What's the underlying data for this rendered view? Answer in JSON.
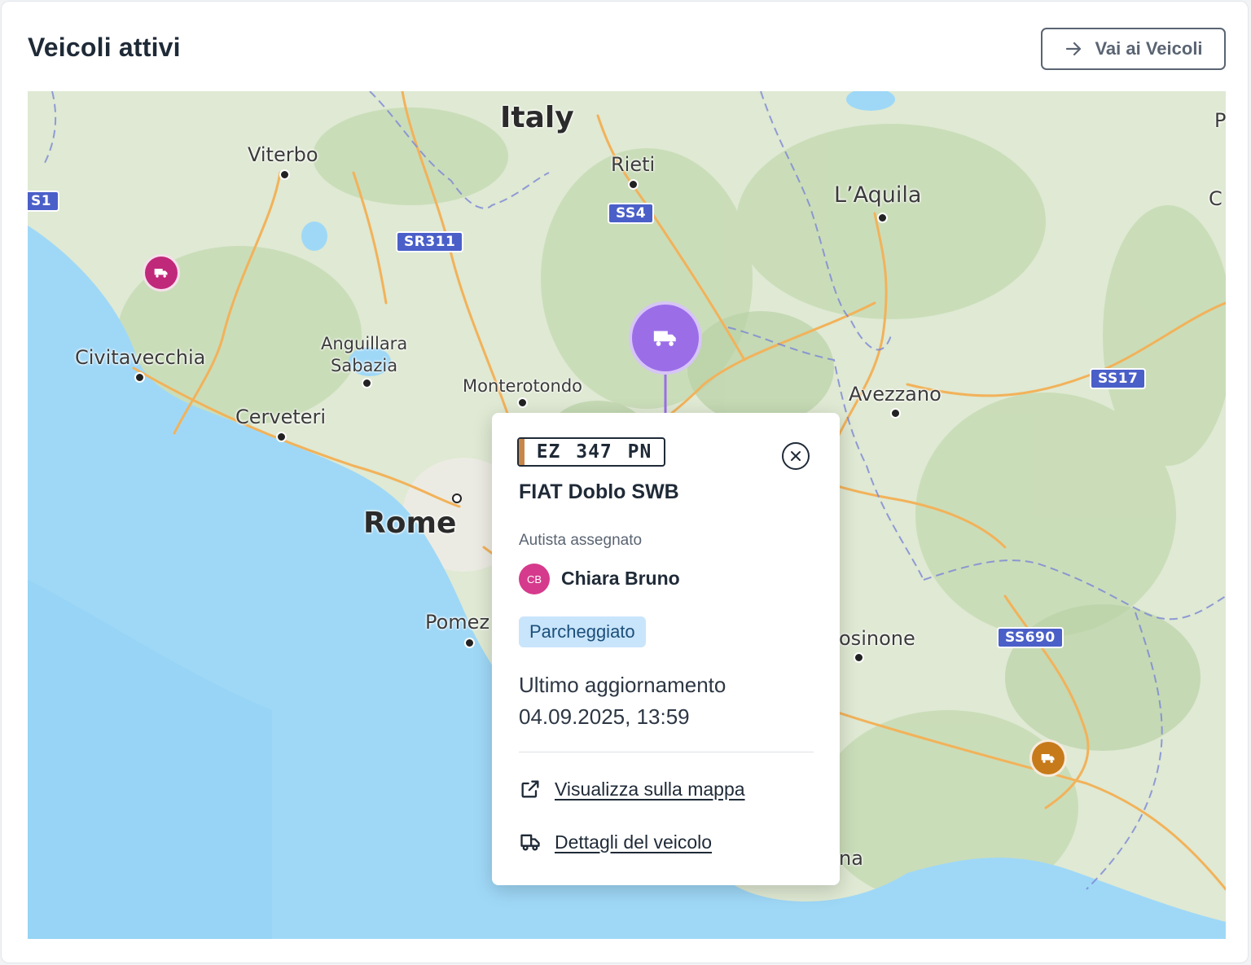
{
  "header": {
    "title": "Veicoli attivi",
    "go_button_label": "Vai ai Veicoli"
  },
  "map": {
    "labels": {
      "italy": "Italy",
      "viterbo": "Viterbo",
      "rieti": "Rieti",
      "laquila": "L’Aquila",
      "civitavecchia": "Civitavecchia",
      "anguillara": "Anguillara",
      "sabazia": "Sabazia",
      "monterotondo": "Monterotondo",
      "avezzano": "Avezzano",
      "cerveteri": "Cerveteri",
      "rome": "Rome",
      "pomezia": "Pomez",
      "frosinone": "osinone",
      "terracina": "na",
      "edge_p": "P",
      "edge_c": "C"
    },
    "road_shields": {
      "s1": "S1",
      "sr311": "SR311",
      "ss4": "SS4",
      "ss17": "SS17",
      "ss690": "SS690"
    },
    "colors": {
      "sea": "#9fd8f7",
      "land": "#dfe9d3",
      "road": "#f2b25a",
      "marker_selected": "#9b6ee8",
      "marker_magenta": "#c0287a",
      "marker_orange": "#c77a1a"
    }
  },
  "popup": {
    "plate": "EZ 347 PN",
    "vehicle_name": "FIAT Doblo SWB",
    "driver_label": "Autista assegnato",
    "driver_initials": "CB",
    "driver_name": "Chiara Bruno",
    "status": "Parcheggiato",
    "update_label": "Ultimo aggiornamento",
    "update_value": "04.09.2025, 13:59",
    "action_map": "Visualizza sulla mappa",
    "action_details": "Dettagli del veicolo",
    "icons": {
      "close": "close-circle-icon",
      "external": "external-link-icon",
      "truck": "truck-outline-icon"
    }
  }
}
